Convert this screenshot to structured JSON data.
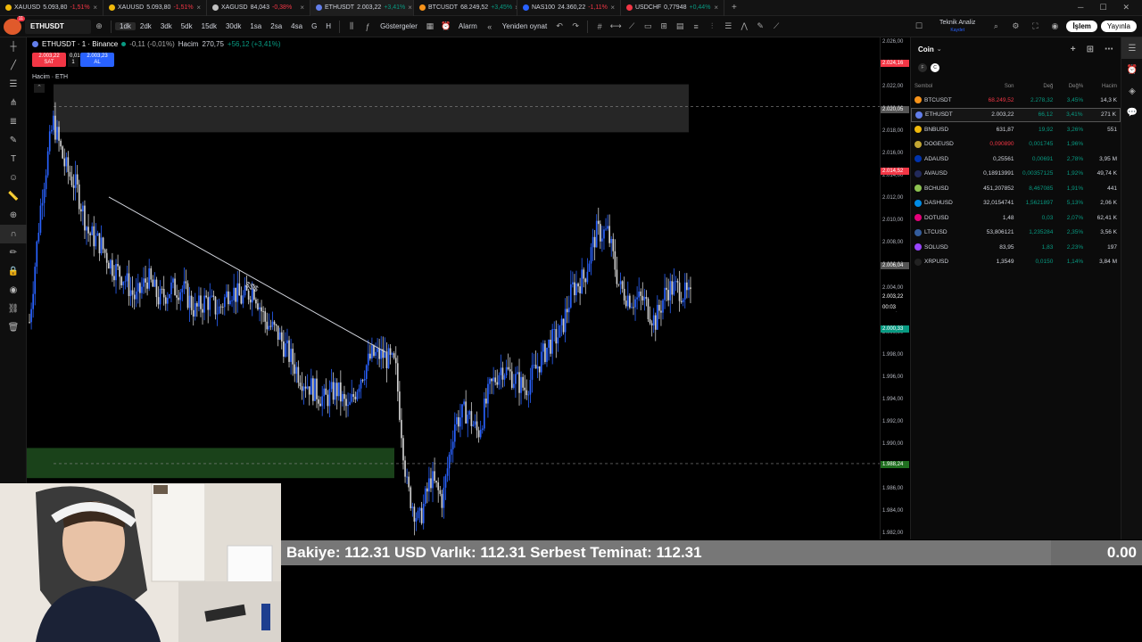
{
  "tabs": [
    {
      "symbol": "XAUUSD",
      "price": "5.093,80",
      "change": "-1,51%",
      "dir": "neg",
      "color": "#f0b90b"
    },
    {
      "symbol": "XAUUSD",
      "price": "5.093,80",
      "change": "-1,51%",
      "dir": "neg",
      "color": "#f0b90b"
    },
    {
      "symbol": "XAGUSD",
      "price": "84,043",
      "change": "-0,38%",
      "dir": "neg",
      "color": "#c0c0c0"
    },
    {
      "symbol": "ETHUSDT",
      "price": "2.003,22",
      "change": "+3,41%",
      "dir": "pos",
      "color": "#627eea"
    },
    {
      "symbol": "BTCUSDT",
      "price": "68.249,52",
      "change": "+3,45%",
      "dir": "pos",
      "color": "#f7931a"
    },
    {
      "symbol": "NAS100",
      "price": "24.360,22",
      "change": "-1,11%",
      "dir": "neg",
      "color": "#2962ff"
    },
    {
      "symbol": "USDCHF",
      "price": "0,77948",
      "change": "+0,44%",
      "dir": "pos",
      "color": "#f23645"
    }
  ],
  "toolbar": {
    "symbol": "ETHUSDT",
    "intervals": [
      "1dk",
      "2dk",
      "3dk",
      "5dk",
      "15dk",
      "30dk",
      "1sa",
      "2sa",
      "4sa",
      "G",
      "H"
    ],
    "selected_interval": "1dk",
    "indicators_label": "Göstergeler",
    "alarm_label": "Alarm",
    "replay_label": "Yeniden oynat",
    "layout_name": "Teknik Analiz",
    "layout_sub": "Kaydet",
    "trade_label": "İşlem",
    "publish_label": "Yayınla",
    "notif_count": "11"
  },
  "legend": {
    "pair": "ETHUSDT · 1 · Binance",
    "change": "-0,11 (-0,01%)",
    "volume_label": "Hacim",
    "volume_value": "270,75",
    "volume_change": "+56,12 (+3,41%)",
    "sell_price": "2.003,22",
    "sell_label": "SAT",
    "spread": "0,01",
    "qty": "1",
    "buy_price": "2.003,23",
    "buy_label": "AL",
    "vol_pane_label": "Hacim · ETH"
  },
  "chart_annotation": "$$$",
  "chart_data": {
    "type": "candlestick",
    "symbol": "ETHUSDT",
    "interval": "1",
    "exchange": "Binance",
    "y_ticks": [
      2026,
      2024,
      2022,
      2020,
      2018,
      2016,
      2014,
      2012,
      2010,
      2008,
      2006,
      2004,
      2002,
      2000,
      1998,
      1996,
      1994,
      1992,
      1990,
      1988,
      1986,
      1984,
      1982
    ],
    "y_range": [
      1981.5,
      2026.5
    ],
    "series": [
      {
        "name": "close",
        "values": [
          2001,
          2012,
          2019,
          2015,
          2013,
          2009,
          2008,
          2006,
          2005,
          2003,
          2005,
          2003,
          2004,
          2004,
          2002,
          2003,
          2002,
          2004,
          2003,
          2004,
          2001,
          2000,
          1998,
          1996,
          1995,
          1994,
          1995,
          1993,
          1996,
          1998,
          1998,
          1997,
          1986,
          1983,
          1987,
          1985,
          1992,
          1993,
          1991,
          1995,
          1997,
          1996,
          1995,
          1997,
          1999,
          2000,
          2004,
          2005,
          2009,
          2009,
          2004,
          2003,
          2003,
          2001,
          2004,
          2004,
          2003
        ]
      }
    ],
    "zones": [
      {
        "type": "resistance",
        "from": 2018,
        "to": 2022.3,
        "color": "#2a2a2a"
      },
      {
        "type": "support",
        "from": 1987,
        "to": 1989.7,
        "color": "#1f4d1f"
      }
    ],
    "dashed_levels": [
      2020.3,
      1988.3
    ]
  },
  "price_axis": {
    "ticks": [
      "2.026,00",
      "2.024,00",
      "2.022,00",
      "2.020,00",
      "2.018,00",
      "2.016,00",
      "2.014,00",
      "2.012,00",
      "2.010,00",
      "2.008,00",
      "2.006,00",
      "2.004,00",
      "2.002,00",
      "2.000,00",
      "1.998,00",
      "1.996,00",
      "1.994,00",
      "1.992,00",
      "1.990,00",
      "1.988,00",
      "1.986,00",
      "1.984,00",
      "1.982,00"
    ],
    "tags": [
      {
        "value": "2.024,16",
        "color": "#f23645"
      },
      {
        "value": "2.020,05",
        "color": "#555555"
      },
      {
        "value": "2.014,52",
        "color": "#f23645"
      },
      {
        "value": "2.006,04",
        "color": "#555555"
      },
      {
        "value": "2.003,22",
        "color": "#000000"
      },
      {
        "value": "00:03",
        "color": "#000000"
      },
      {
        "value": "2.000,33",
        "color": "#089981"
      },
      {
        "value": "1.988,24",
        "color": "#1f6f1f"
      }
    ]
  },
  "watchlist": {
    "title": "Coin",
    "chips": [
      "F",
      "C"
    ],
    "headers": {
      "symbol": "Sembol",
      "last": "Son",
      "chg": "Değ",
      "pct": "Değ%",
      "vol": "Hacim"
    },
    "rows": [
      {
        "symbol": "BTCUSDT",
        "last": "68.249,52",
        "chg": "2.278,32",
        "pct": "3,45%",
        "vol": "14,3 K",
        "color": "#f7931a",
        "last_dir": "neg"
      },
      {
        "symbol": "ETHUSDT",
        "last": "2.003,22",
        "chg": "66,12",
        "pct": "3,41%",
        "vol": "271 K",
        "color": "#627eea",
        "last_dir": "plain"
      },
      {
        "symbol": "BNBUSD",
        "last": "631,87",
        "chg": "19,92",
        "pct": "3,26%",
        "vol": "551",
        "color": "#f0b90b",
        "last_dir": "plain"
      },
      {
        "symbol": "DOGEUSD",
        "last": "0,090890",
        "chg": "0,001745",
        "pct": "1,96%",
        "vol": "",
        "color": "#c2a633",
        "last_dir": "neg"
      },
      {
        "symbol": "ADAUSD",
        "last": "0,25561",
        "chg": "0,00691",
        "pct": "2,78%",
        "vol": "3,95 M",
        "color": "#0033ad",
        "last_dir": "plain"
      },
      {
        "symbol": "AVAUSD",
        "last": "0,18913991",
        "chg": "0,00357125",
        "pct": "1,92%",
        "vol": "49,74 K",
        "color": "#222a5a",
        "last_dir": "plain"
      },
      {
        "symbol": "BCHUSD",
        "last": "451,207852",
        "chg": "8,467085",
        "pct": "1,91%",
        "vol": "441",
        "color": "#8dc351",
        "last_dir": "plain"
      },
      {
        "symbol": "DASHUSD",
        "last": "32,0154741",
        "chg": "1,5621897",
        "pct": "5,13%",
        "vol": "2,06 K",
        "color": "#008ce7",
        "last_dir": "plain"
      },
      {
        "symbol": "DOTUSD",
        "last": "1,48",
        "chg": "0,03",
        "pct": "2,07%",
        "vol": "62,41 K",
        "color": "#e6007a",
        "last_dir": "plain"
      },
      {
        "symbol": "LTCUSD",
        "last": "53,806121",
        "chg": "1,235284",
        "pct": "2,35%",
        "vol": "3,56 K",
        "color": "#345d9d",
        "last_dir": "plain"
      },
      {
        "symbol": "SOLUSD",
        "last": "83,95",
        "chg": "1,83",
        "pct": "2,23%",
        "vol": "197",
        "color": "#9945ff",
        "last_dir": "plain"
      },
      {
        "symbol": "XRPUSD",
        "last": "1,3549",
        "chg": "0,0150",
        "pct": "1,14%",
        "vol": "3,84 M",
        "color": "#222222",
        "last_dir": "plain"
      }
    ]
  },
  "balance": {
    "text": "Bakiye: 112.31 USD  Varlık: 112.31  Serbest Teminat: 112.31",
    "right_value": "0.00"
  }
}
